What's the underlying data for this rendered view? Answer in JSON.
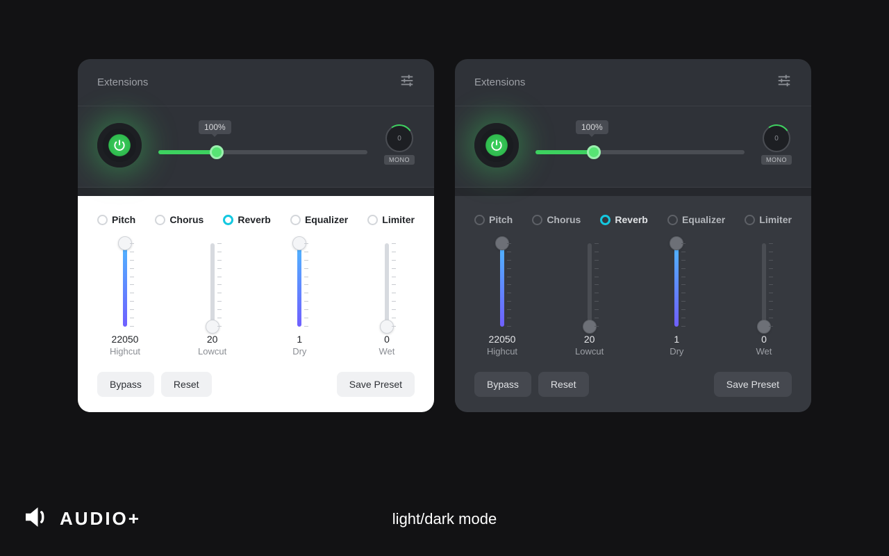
{
  "brand": {
    "name": "AUDIO+"
  },
  "caption": "light/dark mode",
  "panel": {
    "title": "Extensions",
    "volume": {
      "percent_label": "100%",
      "fill_pct": 28
    },
    "mono": {
      "value": "0",
      "label": "MONO"
    },
    "tabs": [
      {
        "label": "Pitch",
        "active": false
      },
      {
        "label": "Chorus",
        "active": false
      },
      {
        "label": "Reverb",
        "active": true
      },
      {
        "label": "Equalizer",
        "active": false
      },
      {
        "label": "Limiter",
        "active": false
      }
    ],
    "sliders": [
      {
        "value": "22050",
        "label": "Highcut",
        "pos": 0,
        "filled": true
      },
      {
        "value": "20",
        "label": "Lowcut",
        "pos": 100,
        "filled": false
      },
      {
        "value": "1",
        "label": "Dry",
        "pos": 0,
        "filled": true
      },
      {
        "value": "0",
        "label": "Wet",
        "pos": 100,
        "filled": false
      }
    ],
    "buttons": {
      "bypass": "Bypass",
      "reset": "Reset",
      "save": "Save Preset"
    }
  },
  "colors": {
    "accent_green": "#3dd15f",
    "accent_cyan": "#14c8e0",
    "gradient_top": "#4fb7ff",
    "gradient_bottom": "#6f5fff"
  }
}
